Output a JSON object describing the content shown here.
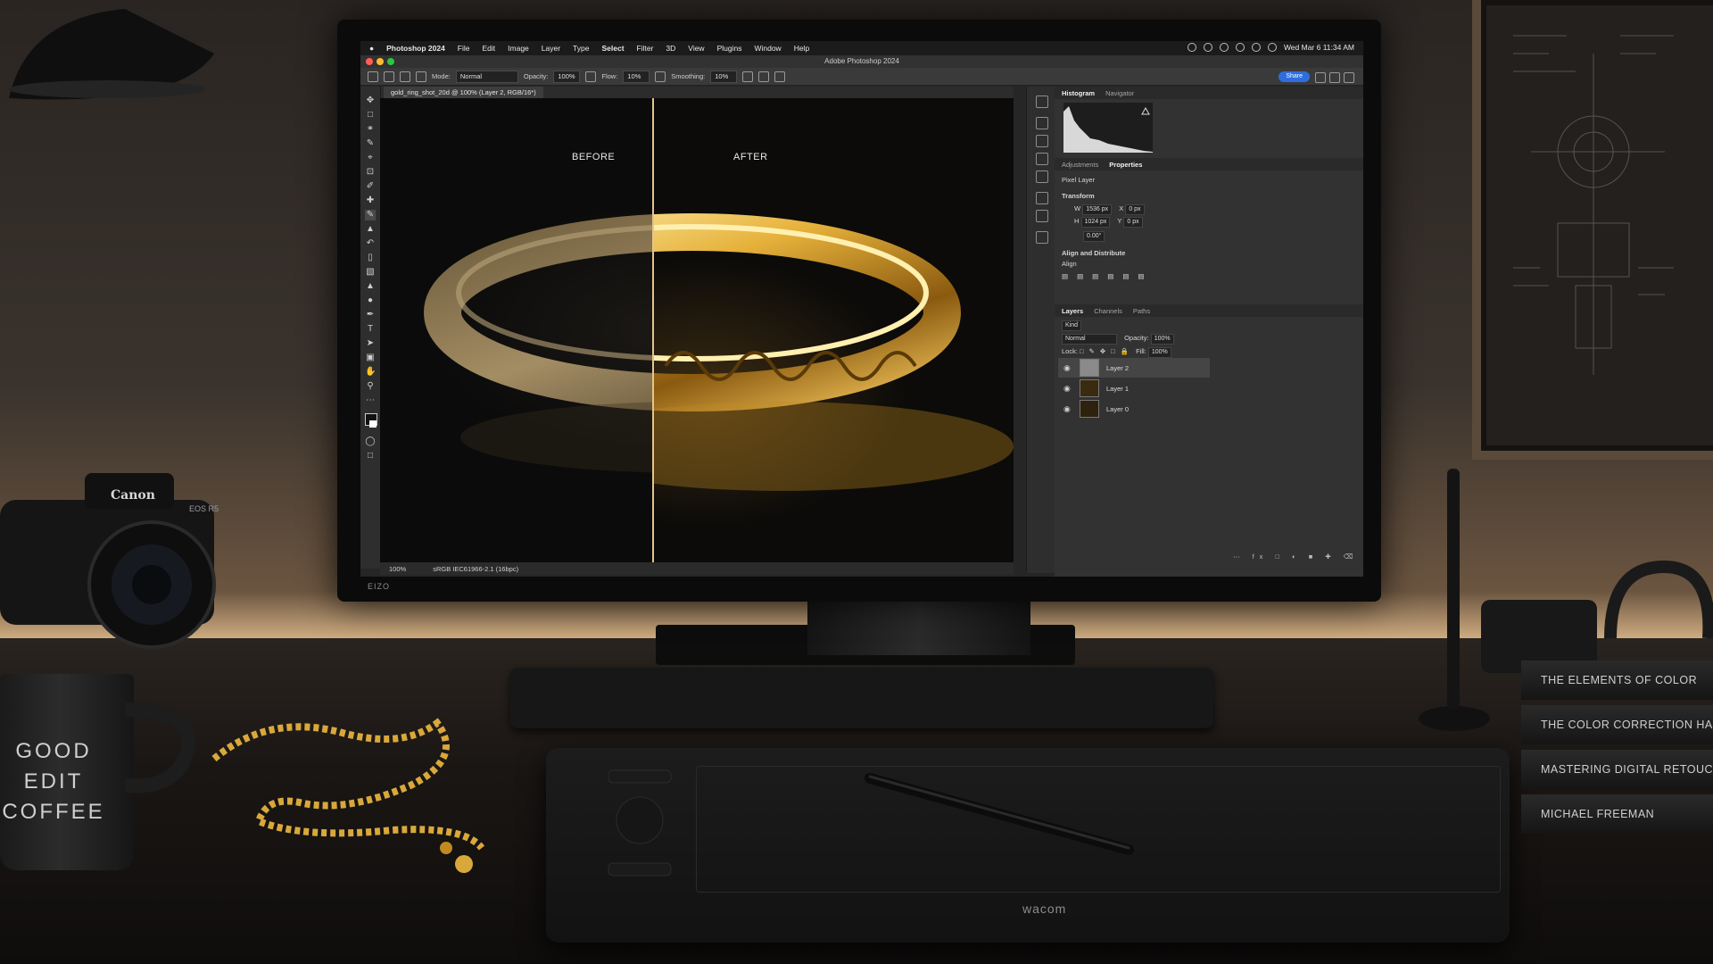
{
  "menubar": {
    "app": "Photoshop 2024",
    "items": [
      "File",
      "Edit",
      "Image",
      "Layer",
      "Type",
      "Select",
      "Filter",
      "3D",
      "View",
      "Plugins",
      "Window",
      "Help"
    ],
    "clock": "Wed Mar 6  11:34 AM"
  },
  "window": {
    "title": "Adobe Photoshop 2024"
  },
  "options": {
    "mode_label": "Mode:",
    "mode_value": "Normal",
    "opacity_label": "Opacity:",
    "opacity_value": "100%",
    "flow_label": "Flow:",
    "flow_value": "10%",
    "smoothing_label": "Smoothing:",
    "smoothing_value": "10%",
    "share": "Share"
  },
  "document": {
    "tab": "gold_ring_shot_20d @ 100% (Layer 2, RGB/16*)"
  },
  "canvas": {
    "before": "BEFORE",
    "after": "AFTER"
  },
  "status": {
    "zoom": "100%",
    "profile": "sRGB IEC61966-2.1 (16bpc)"
  },
  "panels": {
    "top_tabs": [
      "Histogram",
      "Navigator"
    ],
    "prop_tabs": [
      "Adjustments",
      "Properties"
    ],
    "pixel_layer": "Pixel Layer",
    "transform": "Transform",
    "w_label": "W",
    "w_value": "1536 px",
    "h_label": "H",
    "h_value": "1024 px",
    "x_label": "X",
    "x_value": "0 px",
    "y_label": "Y",
    "y_value": "0 px",
    "angle_value": "0.00°",
    "align_heading": "Align and Distribute",
    "align_label": "Align",
    "layer_tabs": [
      "Layers",
      "Channels",
      "Paths"
    ],
    "kind": "Kind",
    "blend": "Normal",
    "opacity_label": "Opacity:",
    "opacity_value": "100%",
    "lock_label": "Lock:",
    "fill_label": "Fill:",
    "fill_value": "100%",
    "layers": [
      "Layer 2",
      "Layer 1",
      "Layer 0"
    ]
  },
  "hardware": {
    "monitor_brand": "EIZO",
    "camera_brand": "Canon",
    "camera_model": "EOS R5",
    "tablet_brand": "wacom"
  },
  "mug": {
    "line1": "GOOD",
    "line2": "EDIT",
    "line3": "COFFEE"
  },
  "books": [
    "THE ELEMENTS OF COLOR",
    "THE COLOR CORRECTION HANDBOOK",
    "MASTERING DIGITAL RETOUCHING",
    "MICHAEL FREEMAN"
  ],
  "colors": {
    "accent_blue": "#2f6ddf",
    "gold": "#d9a83a",
    "divider": "#e6c48c"
  }
}
